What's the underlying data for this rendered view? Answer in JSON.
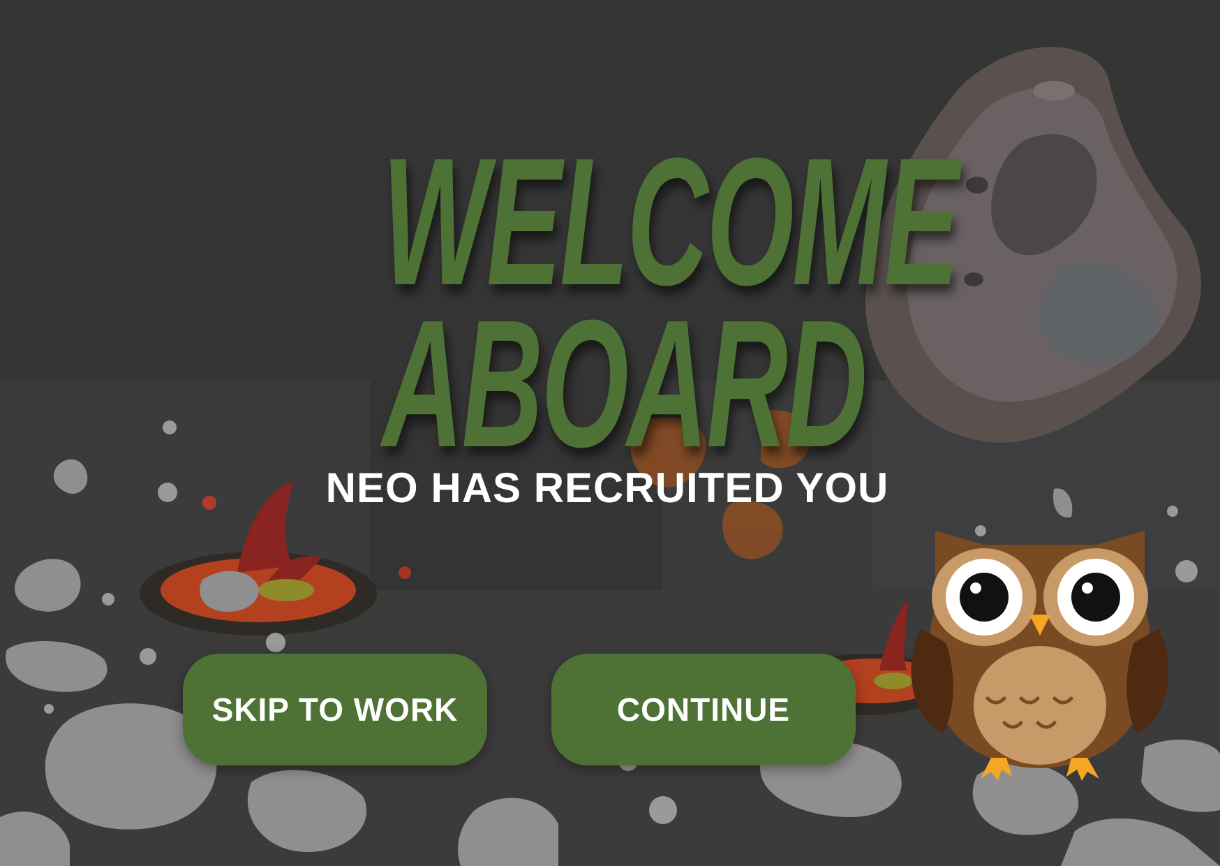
{
  "title": {
    "line1": "WELCOME",
    "line2": "ABOARD"
  },
  "subtitle": "NEO HAS RECRUITED YOU",
  "buttons": {
    "skip_label": "SKIP TO WORK",
    "continue_label": "CONTINUE"
  },
  "mascot": {
    "name": "owl-mascot",
    "icon": "owl-icon"
  },
  "colors": {
    "background": "#353535",
    "accent_green": "#4e7235",
    "text_white": "#ffffff",
    "owl_brown": "#7a4a22",
    "owl_belly": "#c89a68",
    "owl_beak": "#f5a623"
  }
}
